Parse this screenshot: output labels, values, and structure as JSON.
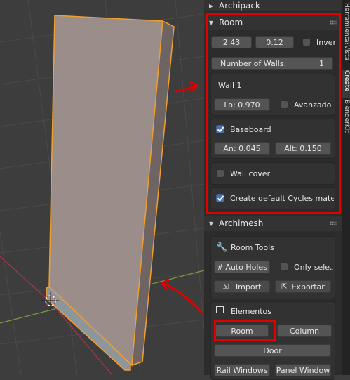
{
  "archipack": {
    "title": "Archipack"
  },
  "room": {
    "title": "Room",
    "height_value": "2.43",
    "thickness_value": "0.12",
    "invert_label": "Inver",
    "walls_label": "Number of Walls:",
    "walls_value": "1",
    "wall_title": "Wall 1",
    "length_label": "Lo:  0.970",
    "advanced_label": "Avanzado",
    "baseboard_label": "Baseboard",
    "baseboard_width": "An:  0.045",
    "baseboard_height": "Alt:  0.150",
    "wall_cover_label": "Wall cover",
    "cycles_label": "Create default Cycles mate.."
  },
  "archimesh": {
    "title": "Archimesh",
    "room_tools_title": "Room Tools",
    "auto_holes_label": "Auto Holes",
    "only_selected_label": "Only sele..",
    "import_label": "Import",
    "export_label": "Exportar",
    "elements_title": "Elementos",
    "room_button": "Room",
    "column_button": "Column",
    "door_button": "Door",
    "rail_windows_button": "Rail Windows",
    "panel_window_button": "Panel Window"
  },
  "tabs": [
    "Herramientas",
    "Vista",
    "Create",
    "BlenderKit"
  ],
  "colors": {
    "annotation": "#e00000",
    "selection_outline": "#f0a030",
    "checkbox_on": "#4772b3"
  }
}
